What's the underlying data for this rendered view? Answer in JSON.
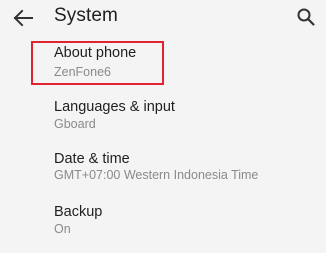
{
  "header": {
    "title": "System",
    "back_icon": "arrow-left-icon",
    "search_icon": "search-icon"
  },
  "settings": [
    {
      "label": "About phone",
      "value": "ZenFone6"
    },
    {
      "label": "Languages & input",
      "value": "Gboard"
    },
    {
      "label": "Date & time",
      "value": "GMT+07:00 Western Indonesia Time"
    },
    {
      "label": "Backup",
      "value": "On"
    }
  ],
  "colors": {
    "highlight": "#e0242f",
    "primary_text": "#1f1f1f",
    "secondary_text": "#8a8a8a",
    "background": "#f4f4f4"
  }
}
